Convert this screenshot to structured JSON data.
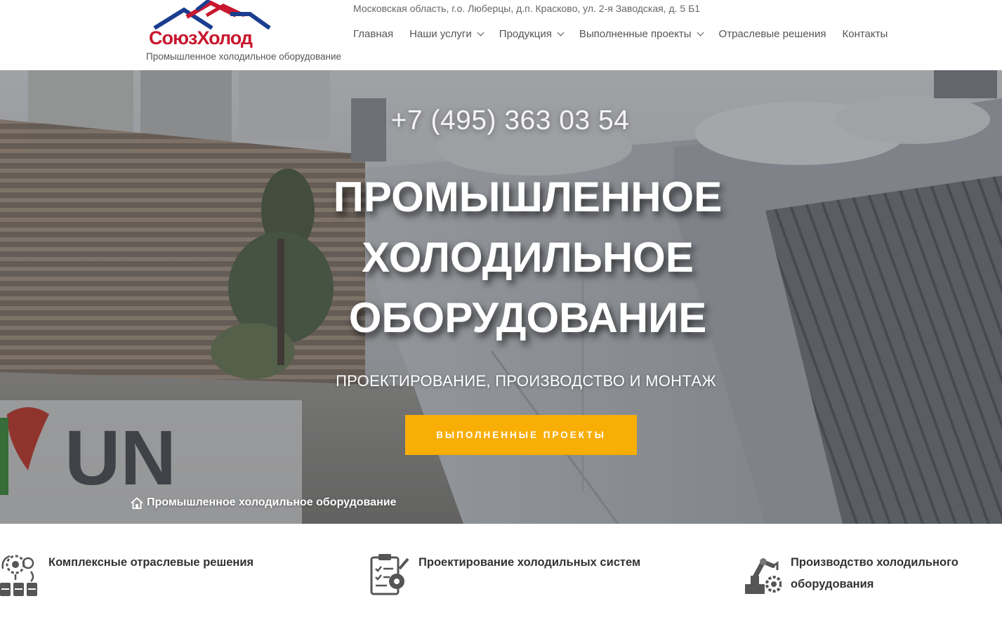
{
  "header": {
    "logo_text": "СоюзХолод",
    "tagline": "Промышленное холодильное оборудование",
    "address": "Московская область, г.о. Люберцы, д.п. Красково, ул. 2-я Заводская, д. 5 Б1",
    "nav": [
      {
        "label": "Главная",
        "dropdown": false
      },
      {
        "label": "Наши услуги",
        "dropdown": true
      },
      {
        "label": "Продукция",
        "dropdown": true
      },
      {
        "label": "Выполненные проекты",
        "dropdown": true
      },
      {
        "label": "Отраслевые решения",
        "dropdown": false
      },
      {
        "label": "Контакты",
        "dropdown": false
      }
    ]
  },
  "hero": {
    "phone": "+7 (495) 363 03 54",
    "title_lines": [
      "ПРОМЫШЛЕННОЕ",
      "ХОЛОДИЛЬНОЕ",
      "ОБОРУДОВАНИЕ"
    ],
    "subtitle": "ПРОЕКТИРОВАНИЕ, ПРОИЗВОДСТВО И МОНТАЖ",
    "cta_label": "ВЫПОЛНЕННЫЕ ПРОЕКТЫ",
    "background_sign_text": "UN",
    "breadcrumb": "Промышленное холодильное оборудование"
  },
  "features": [
    {
      "icon": "industry-solutions-icon",
      "lines": [
        "Комплексные отраслевые решения"
      ]
    },
    {
      "icon": "design-clipboard-icon",
      "lines": [
        "Проектирование холодильных систем"
      ]
    },
    {
      "icon": "production-robot-icon",
      "lines": [
        "Производство холодильного",
        "оборудования"
      ]
    }
  ],
  "colors": {
    "cta": "#f9ae06",
    "logo_red": "#c8172e",
    "logo_blue": "#1c3d8f",
    "nav_text": "#555555",
    "feature_text": "#333333"
  }
}
